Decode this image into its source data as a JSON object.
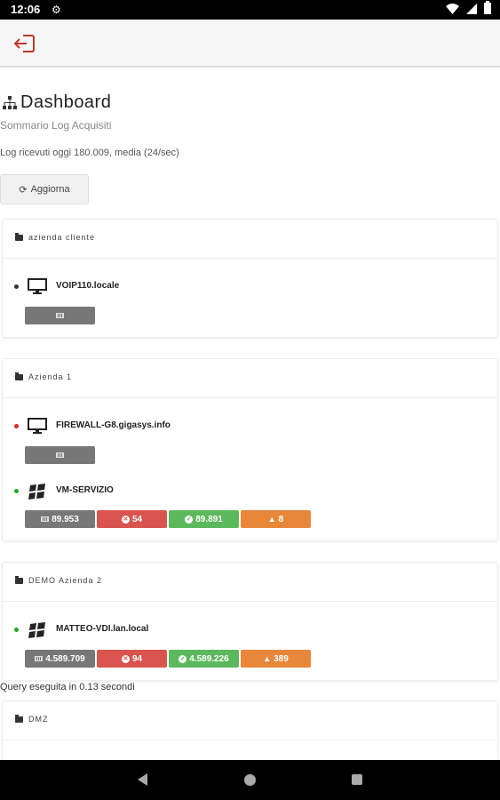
{
  "status_bar": {
    "time": "12:06"
  },
  "page": {
    "title": "Dashboard",
    "subtitle": "Sommario Log Acquisiti",
    "log_info": "Log ricevuti oggi 180.009, media (24/sec)",
    "refresh_label": "Aggiorna",
    "query_text": "Query eseguita in  0.13 secondi"
  },
  "colors": {
    "online": "#22aa22",
    "offline": "#dd2222",
    "unknown": "#333333"
  },
  "groups": [
    {
      "name": "azienda cliente",
      "hosts": [
        {
          "name": "VOIP110.locale",
          "status": "unknown",
          "icon": "monitor-icon",
          "badges": [
            {
              "type": "gray",
              "text": ""
            }
          ]
        }
      ]
    },
    {
      "name": "Azienda 1",
      "hosts": [
        {
          "name": "FIREWALL-G8.gigasys.info",
          "status": "offline",
          "icon": "monitor-icon",
          "badges": [
            {
              "type": "gray",
              "text": ""
            }
          ]
        },
        {
          "name": "VM-SERVIZIO",
          "status": "online",
          "icon": "windows-icon",
          "badges": [
            {
              "type": "gray",
              "text": "89.953"
            },
            {
              "type": "red",
              "text": "54"
            },
            {
              "type": "green",
              "text": "89.891"
            },
            {
              "type": "orange",
              "text": "8"
            }
          ]
        }
      ]
    },
    {
      "name": "DEMO Azienda 2",
      "hosts": [
        {
          "name": "MATTEO-VDI.lan.local",
          "status": "online",
          "icon": "windows-icon",
          "badges": [
            {
              "type": "gray",
              "text": "4.589.709"
            },
            {
              "type": "red",
              "text": "94"
            },
            {
              "type": "green",
              "text": "4.589.226"
            },
            {
              "type": "orange",
              "text": "389"
            }
          ]
        }
      ]
    },
    {
      "name": "DMZ",
      "hosts": []
    }
  ]
}
